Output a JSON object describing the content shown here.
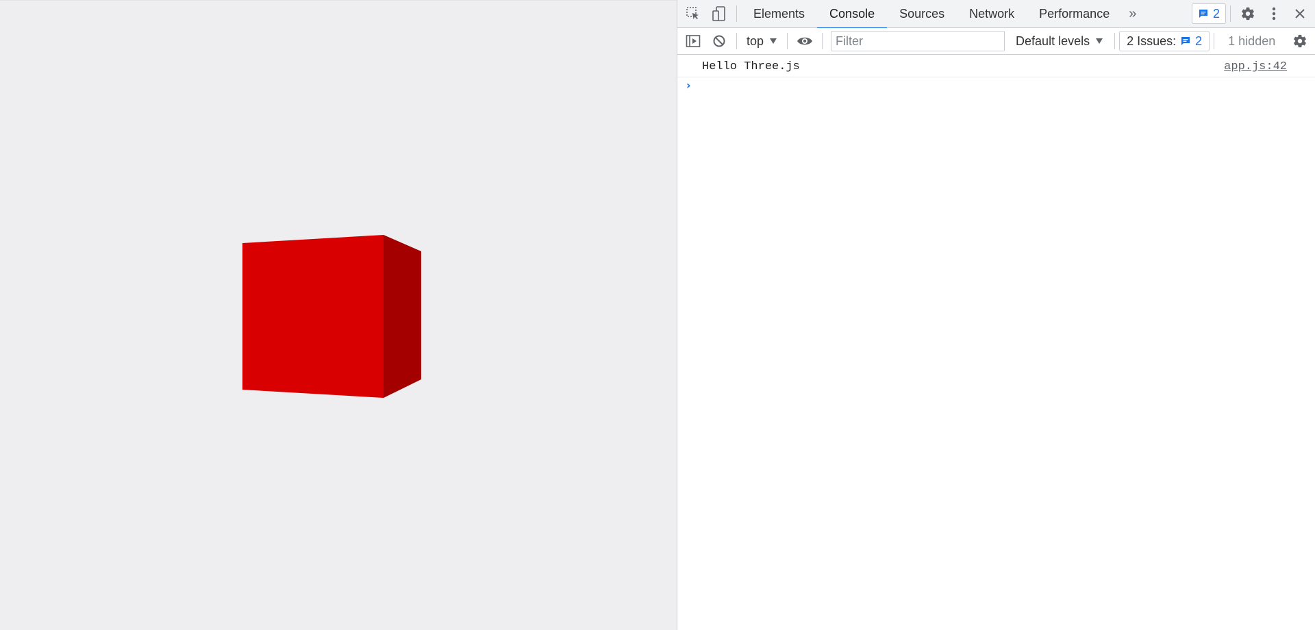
{
  "viewport": {
    "cube_colors": {
      "front": "#d80000",
      "side": "#a50000"
    },
    "background": "#eeeef0"
  },
  "devtools": {
    "tabs": [
      {
        "label": "Elements",
        "active": false
      },
      {
        "label": "Console",
        "active": true
      },
      {
        "label": "Sources",
        "active": false
      },
      {
        "label": "Network",
        "active": false
      },
      {
        "label": "Performance",
        "active": false
      }
    ],
    "more_tabs_icon": "chevron-double-right-icon",
    "issues_badge_count": "2",
    "toolbar": {
      "context": "top",
      "filter_placeholder": "Filter",
      "levels": "Default levels",
      "issues_label": "2 Issues:",
      "issues_count": "2",
      "hidden": "1 hidden"
    },
    "console": {
      "messages": [
        {
          "text": "Hello Three.js",
          "source": "app.js:42"
        }
      ]
    },
    "accent": "#1a73e8"
  }
}
